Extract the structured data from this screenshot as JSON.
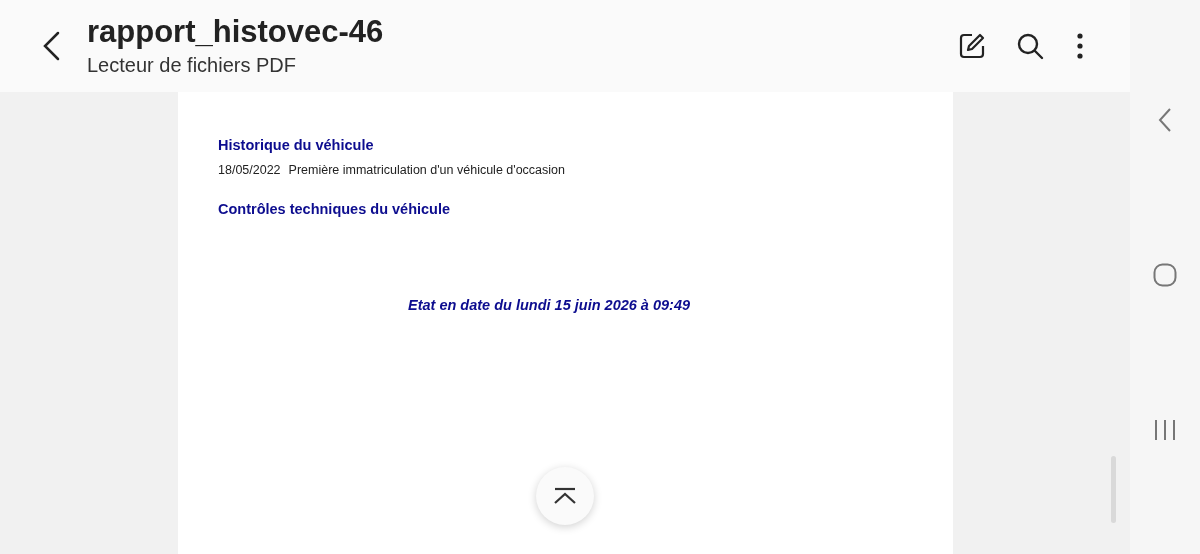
{
  "app_bar": {
    "title": "rapport_histovec-46",
    "subtitle": "Lecteur de fichiers PDF"
  },
  "document": {
    "sections": [
      {
        "heading": "Historique du véhicule",
        "entries": [
          {
            "date": "18/05/2022",
            "text": "Première immatriculation d'un véhicule d'occasion"
          }
        ]
      },
      {
        "heading": "Contrôles techniques du véhicule"
      }
    ],
    "footer": "Etat en date du lundi 15 juin 2026 à 09:49"
  }
}
